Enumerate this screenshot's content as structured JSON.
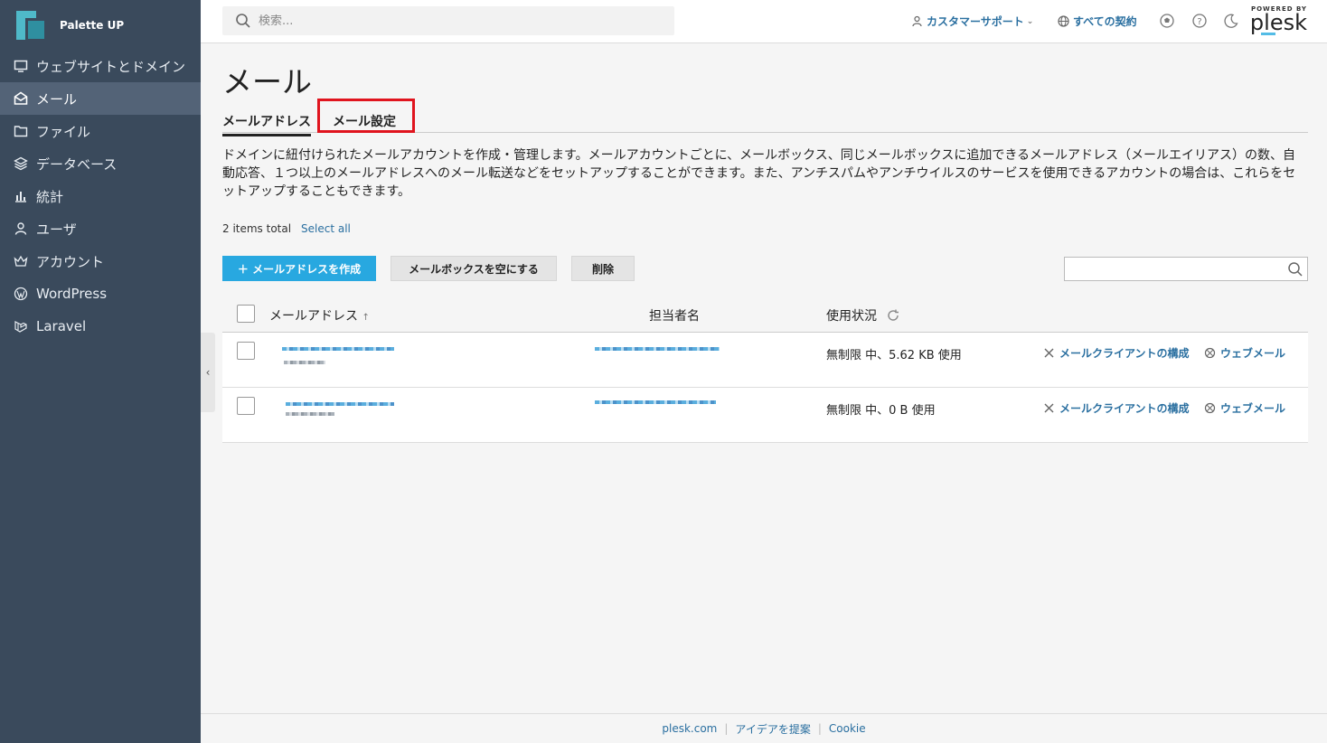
{
  "brand": {
    "name": "Palette UP"
  },
  "sidebar": {
    "items": [
      {
        "label": "ウェブサイトとドメイン",
        "icon": "monitor-icon"
      },
      {
        "label": "メール",
        "icon": "mail-icon",
        "active": true
      },
      {
        "label": "ファイル",
        "icon": "folder-icon"
      },
      {
        "label": "データベース",
        "icon": "layers-icon"
      },
      {
        "label": "統計",
        "icon": "bar-chart-icon"
      },
      {
        "label": "ユーザ",
        "icon": "user-icon"
      },
      {
        "label": "アカウント",
        "icon": "crown-icon"
      },
      {
        "label": "WordPress",
        "icon": "wordpress-icon"
      },
      {
        "label": "Laravel",
        "icon": "laravel-icon"
      }
    ]
  },
  "header": {
    "search_placeholder": "検索...",
    "support_label": "カスタマーサポート",
    "subscriptions_label": "すべての契約",
    "powered_by": "POWERED BY",
    "plesk": "plesk"
  },
  "page": {
    "title": "メール",
    "tabs": [
      {
        "label": "メールアドレス",
        "active": true
      },
      {
        "label": "メール設定",
        "highlighted": true
      }
    ],
    "description": "ドメインに紐付けられたメールアカウントを作成・管理します。メールアカウントごとに、メールボックス、同じメールボックスに追加できるメールアドレス（メールエイリアス）の数、自動応答、１つ以上のメールアドレスへのメール転送などをセットアップすることができます。また、アンチスパムやアンチウイルスのサービスを使用できるアカウントの場合は、これらをセットアップすることもできます。",
    "items_total": "2 items total",
    "select_all": "Select all"
  },
  "toolbar": {
    "create_label": "＋ メールアドレスを作成",
    "empty_mailbox_label": "メールボックスを空にする",
    "delete_label": "削除"
  },
  "table": {
    "columns": [
      "メールアドレス",
      "担当者名",
      "使用状況"
    ],
    "sort_indicator": "↑",
    "rows": [
      {
        "usage": "無制限 中、5.62 KB 使用",
        "configure": "メールクライアントの構成",
        "webmail": "ウェブメール"
      },
      {
        "usage": "無制限 中、0 B 使用",
        "configure": "メールクライアントの構成",
        "webmail": "ウェブメール"
      }
    ]
  },
  "footer": {
    "links": [
      "plesk.com",
      "アイデアを提案",
      "Cookie"
    ]
  },
  "colors": {
    "sidebar_bg": "#3a4a5c",
    "sidebar_active": "#536377",
    "primary_button": "#28a8e0",
    "link": "#2a6fa0",
    "highlight_border": "#e0141e"
  }
}
